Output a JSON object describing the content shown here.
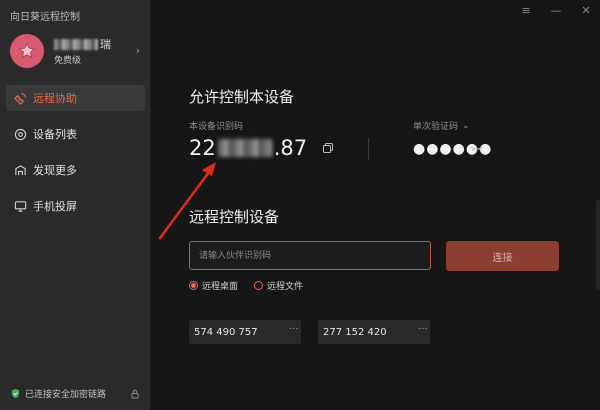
{
  "app": {
    "title": "向日葵远程控制"
  },
  "window_controls": {
    "menu": "≡",
    "minimize": "—",
    "close": "✕"
  },
  "profile": {
    "name_suffix": "瑞",
    "level": "免费级",
    "chevron": "›"
  },
  "sidebar": {
    "items": [
      {
        "label": "远程协助",
        "icon": "remote-assist-icon",
        "active": true
      },
      {
        "label": "设备列表",
        "icon": "device-list-icon",
        "active": false
      },
      {
        "label": "发现更多",
        "icon": "discover-icon",
        "active": false
      },
      {
        "label": "手机投屏",
        "icon": "screen-cast-icon",
        "active": false
      }
    ],
    "footer": "已连接安全加密链路"
  },
  "allow": {
    "heading": "允许控制本设备",
    "device_id_label": "本设备识别码",
    "device_id_prefix": "22",
    "device_id_suffix": ".87",
    "code_label": "单次验证码",
    "code_chevron": "⌄",
    "code_value": "●●●●●●"
  },
  "remote": {
    "heading": "远程控制设备",
    "input_placeholder": "请输入伙伴识别码",
    "connect_label": "连接",
    "modes": [
      {
        "label": "远程桌面",
        "selected": true
      },
      {
        "label": "远程文件",
        "selected": false
      }
    ],
    "recent": [
      {
        "id": "574 490 757",
        "more": "⋮"
      },
      {
        "id": "277 152 420",
        "more": "⋮"
      }
    ]
  },
  "colors": {
    "accent": "#e8664c",
    "arrow": "#e32a1c",
    "sidebar_bg": "#2b2b2b",
    "main_bg": "#161616"
  }
}
